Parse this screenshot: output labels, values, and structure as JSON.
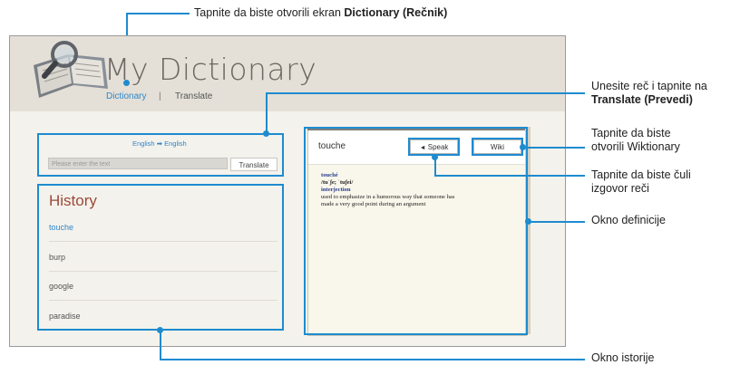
{
  "app": {
    "title": "My Dictionary",
    "nav": {
      "dictionary": "Dictionary",
      "separator": "|",
      "translate": "Translate"
    }
  },
  "translate_panel": {
    "from_lang": "English",
    "arrow": "➡",
    "to_lang": "English",
    "input_placeholder": "Please enter the text",
    "button": "Translate"
  },
  "history": {
    "title": "History",
    "items": [
      {
        "label": "touche",
        "active": true
      },
      {
        "label": "burp",
        "active": false
      },
      {
        "label": "google",
        "active": false
      },
      {
        "label": "paradise",
        "active": false
      }
    ]
  },
  "definition": {
    "word": "touche",
    "speak_button": "Speak",
    "wiki_button": "Wiki",
    "lines": [
      "touché",
      "/tuˈʃe; ˈtuʃei/",
      "interjection",
      "used to emphasize in a humorous way that someone has",
      "made a very good point during an argument"
    ]
  },
  "callouts": {
    "top_prefix": "Tapnite da biste otvorili ekran ",
    "top_bold": "Dictionary (Rečnik)",
    "translate_line1": "Unesite reč i tapnite na",
    "translate_bold": "Translate (Prevedi)",
    "wiki_line1": "Tapnite da biste",
    "wiki_line2": "otvorili Wiktionary",
    "speak_line1": "Tapnite da biste čuli",
    "speak_line2": "izgovor reči",
    "definition_window": "Okno definicije",
    "history_window": "Okno istorije"
  },
  "colors": {
    "accent": "#1e8bcf",
    "link": "#2f86c8",
    "history_title": "#9a4a3a"
  }
}
